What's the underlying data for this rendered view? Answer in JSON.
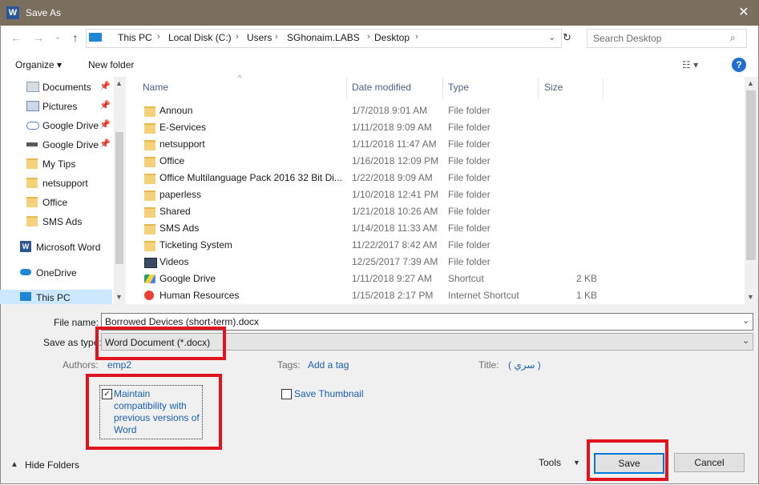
{
  "window": {
    "title": "Save As",
    "app_icon": "W",
    "close_glyph": "✕"
  },
  "nav": {
    "back": "←",
    "forward": "→",
    "recent": "⌄",
    "up": "↑",
    "breadcrumb": [
      "This PC",
      "Local Disk (C:)",
      "Users",
      "SGhonaim.LABS",
      "Desktop"
    ],
    "search_placeholder": "Search Desktop"
  },
  "toolbar": {
    "organize": "Organize ▾",
    "new_folder": "New folder",
    "help": "?"
  },
  "sidebar": {
    "items": [
      {
        "label": "Documents",
        "icon": "documents-icon",
        "pinned": true
      },
      {
        "label": "Pictures",
        "icon": "pictures-icon",
        "pinned": true
      },
      {
        "label": "Google Drive",
        "icon": "cloud-icon",
        "pinned": true
      },
      {
        "label": "Google Drive",
        "icon": "drive-icon",
        "pinned": true
      },
      {
        "label": "My Tips",
        "icon": "folder-icon",
        "pinned": false
      },
      {
        "label": "netsupport",
        "icon": "folder-icon",
        "pinned": false
      },
      {
        "label": "Office",
        "icon": "folder-icon",
        "pinned": false
      },
      {
        "label": "SMS Ads",
        "icon": "folder-icon",
        "pinned": false
      },
      {
        "label": "Microsoft Word",
        "icon": "word-icon",
        "pinned": false
      },
      {
        "label": "OneDrive",
        "icon": "onedrive-icon",
        "pinned": false
      },
      {
        "label": "This PC",
        "icon": "pc-icon",
        "pinned": false
      }
    ]
  },
  "files": {
    "columns": [
      "Name",
      "Date modified",
      "Type",
      "Size"
    ],
    "rows": [
      {
        "name": "Announ",
        "date": "1/7/2018 9:01 AM",
        "type": "File folder",
        "size": ""
      },
      {
        "name": "E-Services",
        "date": "1/11/2018 9:09 AM",
        "type": "File folder",
        "size": ""
      },
      {
        "name": "netsupport",
        "date": "1/11/2018 11:47 AM",
        "type": "File folder",
        "size": ""
      },
      {
        "name": "Office",
        "date": "1/16/2018 12:09 PM",
        "type": "File folder",
        "size": ""
      },
      {
        "name": "Office Multilanguage Pack 2016 32 Bit Di...",
        "date": "1/22/2018 9:09 AM",
        "type": "File folder",
        "size": ""
      },
      {
        "name": "paperless",
        "date": "1/10/2018 12:41 PM",
        "type": "File folder",
        "size": ""
      },
      {
        "name": "Shared",
        "date": "1/21/2018 10:26 AM",
        "type": "File folder",
        "size": ""
      },
      {
        "name": "SMS Ads",
        "date": "1/14/2018 11:33 AM",
        "type": "File folder",
        "size": ""
      },
      {
        "name": "Ticketing System",
        "date": "11/22/2017 8:42 AM",
        "type": "File folder",
        "size": ""
      },
      {
        "name": "Videos",
        "date": "12/25/2017 7:39 AM",
        "type": "File folder",
        "size": ""
      },
      {
        "name": "Google Drive",
        "date": "1/11/2018 9:27 AM",
        "type": "Shortcut",
        "size": "2 KB"
      },
      {
        "name": "Human Resources",
        "date": "1/15/2018 2:17 PM",
        "type": "Internet Shortcut",
        "size": "1 KB"
      }
    ]
  },
  "form": {
    "file_name_label": "File name:",
    "file_name_value": "Borrowed Devices (short-term).docx",
    "save_type_label": "Save as type:",
    "save_type_value": "Word Document (*.docx)",
    "authors_label": "Authors:",
    "authors_value": "emp2",
    "tags_label": "Tags:",
    "tags_value": "Add a tag",
    "title_label": "Title:",
    "title_value": "( سري )",
    "compat_line1": "Maintain",
    "compat_line2": "compatibility with",
    "compat_line3": "previous versions of",
    "compat_line4": "Word",
    "compat_checked": true,
    "thumbnail_label": "Save Thumbnail",
    "thumbnail_checked": false
  },
  "footer": {
    "hide_folders": "Hide Folders",
    "tools": "Tools",
    "save": "Save",
    "cancel": "Cancel"
  },
  "colors": {
    "highlight": "#e0141e",
    "accent": "#1e6fd0",
    "titlebar": "#7a6f5c"
  }
}
